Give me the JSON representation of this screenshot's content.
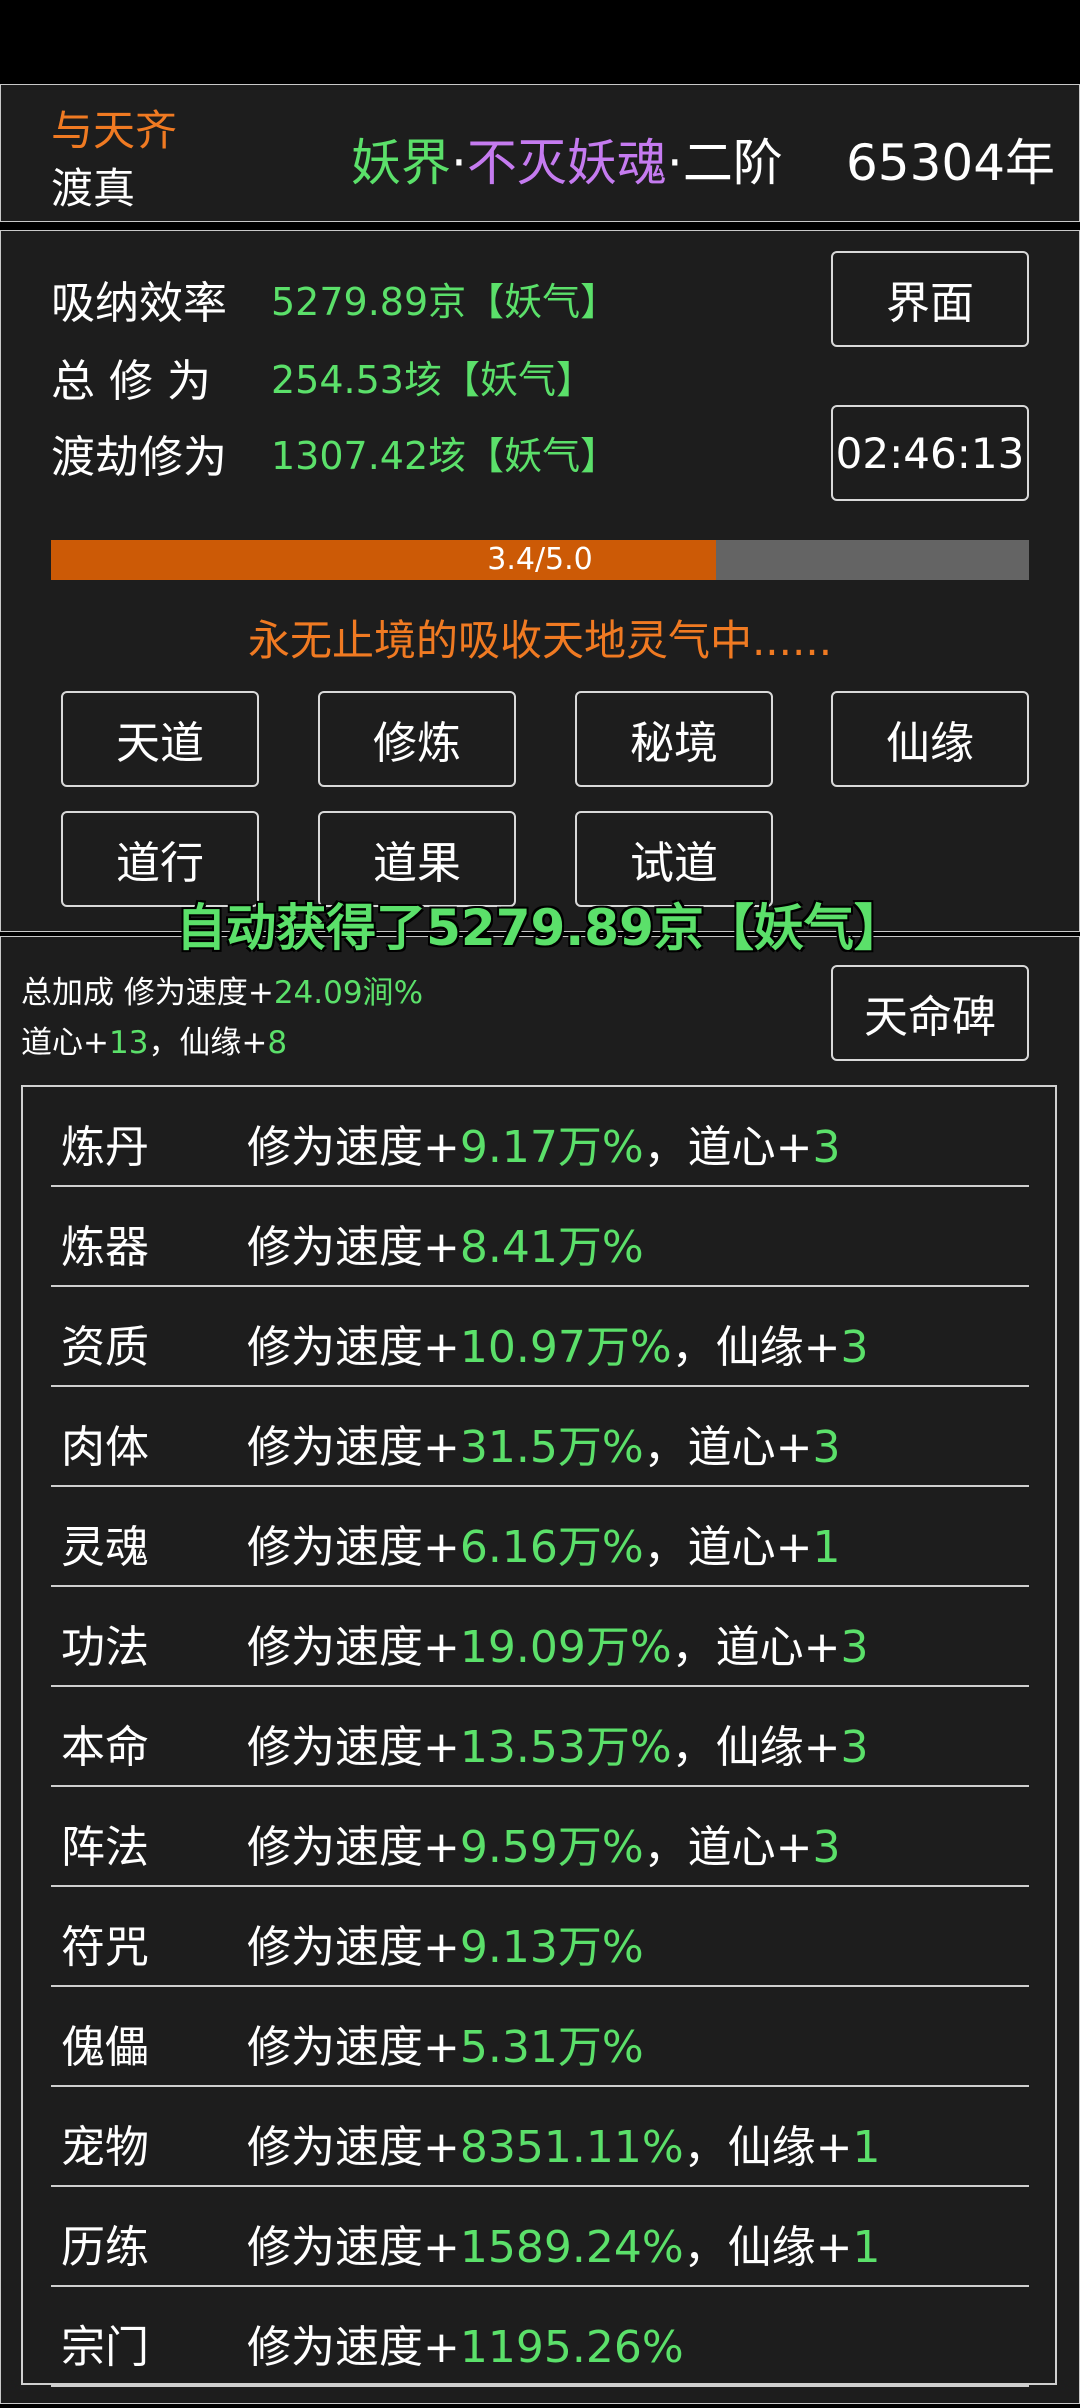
{
  "header": {
    "title": "与天齐",
    "subtitle": "渡真",
    "realm_a": "妖界",
    "dot1": "·",
    "realm_b": "不灭妖魂",
    "dot2": "·",
    "realm_c": "二阶",
    "years": "65304年"
  },
  "stats": {
    "absorb_label": "吸纳效率",
    "absorb_value": "5279.89京【妖气】",
    "total_label": "总 修 为",
    "total_value": "254.53垓【妖气】",
    "tribulation_label": "渡劫修为",
    "tribulation_value": "1307.42垓【妖气】"
  },
  "buttons": {
    "interface": "界面",
    "timer": "02:46:13",
    "grid": [
      "天道",
      "修炼",
      "秘境",
      "仙缘",
      "道行",
      "道果",
      "试道"
    ],
    "monument": "天命碑"
  },
  "progress": {
    "label": "3.4/5.0",
    "current": 3.4,
    "max": 5.0
  },
  "status_text": "永无止境的吸收天地灵气中......",
  "toast": "自动获得了5279.89京【妖气】",
  "bonus": {
    "line1_prefix": "总加成 修为速度+",
    "line1_value": "24.09涧%",
    "line2_a": "道心+",
    "line2_a_val": "13",
    "line2_b": "，仙缘+",
    "line2_b_val": "8"
  },
  "rows": [
    {
      "name": "炼丹",
      "prefix": "修为速度+",
      "value": "9.17万%",
      "extra": "，道心+",
      "extra_val": "3"
    },
    {
      "name": "炼器",
      "prefix": "修为速度+",
      "value": "8.41万%",
      "extra": "",
      "extra_val": ""
    },
    {
      "name": "资质",
      "prefix": "修为速度+",
      "value": "10.97万%",
      "extra": "，仙缘+",
      "extra_val": "3"
    },
    {
      "name": "肉体",
      "prefix": "修为速度+",
      "value": "31.5万%",
      "extra": "，道心+",
      "extra_val": "3"
    },
    {
      "name": "灵魂",
      "prefix": "修为速度+",
      "value": "6.16万%",
      "extra": "，道心+",
      "extra_val": "1"
    },
    {
      "name": "功法",
      "prefix": "修为速度+",
      "value": "19.09万%",
      "extra": "，道心+",
      "extra_val": "3"
    },
    {
      "name": "本命",
      "prefix": "修为速度+",
      "value": "13.53万%",
      "extra": "，仙缘+",
      "extra_val": "3"
    },
    {
      "name": "阵法",
      "prefix": "修为速度+",
      "value": "9.59万%",
      "extra": "，道心+",
      "extra_val": "3"
    },
    {
      "name": "符咒",
      "prefix": "修为速度+",
      "value": "9.13万%",
      "extra": "",
      "extra_val": ""
    },
    {
      "name": "傀儡",
      "prefix": "修为速度+",
      "value": "5.31万%",
      "extra": "",
      "extra_val": ""
    },
    {
      "name": "宠物",
      "prefix": "修为速度+",
      "value": "8351.11%",
      "extra": "，仙缘+",
      "extra_val": "1"
    },
    {
      "name": "历练",
      "prefix": "修为速度+",
      "value": "1589.24%",
      "extra": "，仙缘+",
      "extra_val": "1"
    },
    {
      "name": "宗门",
      "prefix": "修为速度+",
      "value": "1195.26%",
      "extra": "",
      "extra_val": ""
    }
  ]
}
